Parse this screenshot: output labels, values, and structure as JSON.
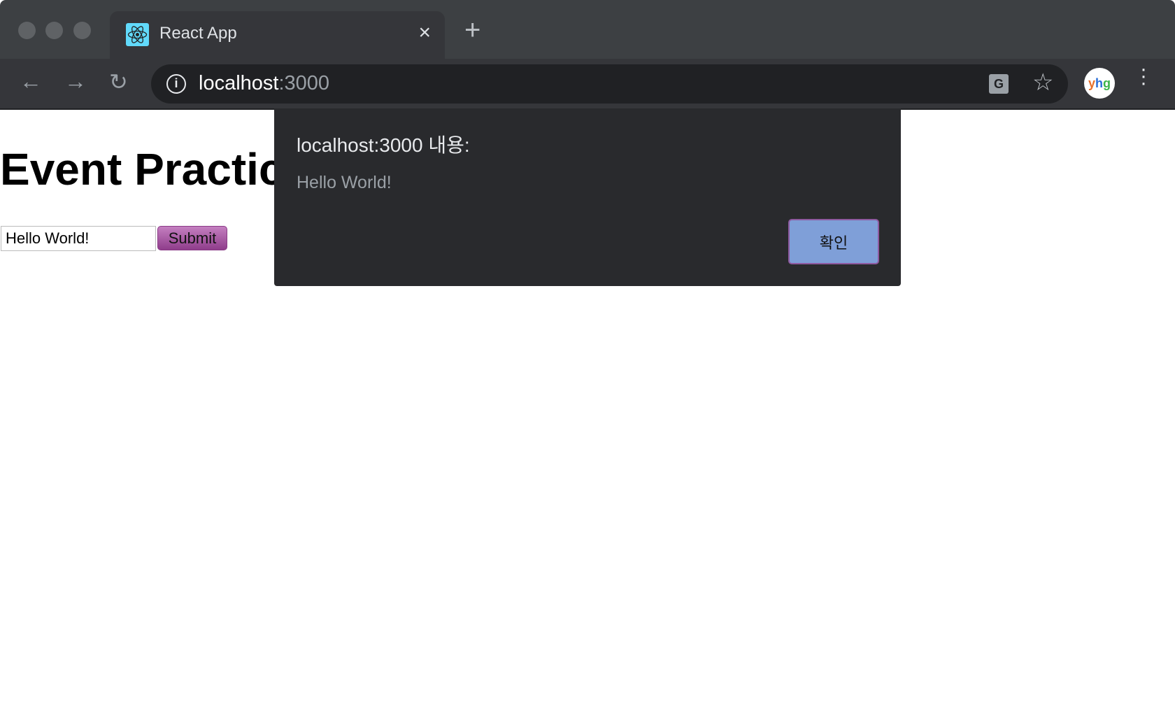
{
  "browser": {
    "tab": {
      "title": "React App",
      "favicon": "react-logo-icon",
      "close": "×"
    },
    "new_tab": "+",
    "url": {
      "host": "localhost",
      "port": ":3000"
    },
    "avatar_text": "yhg",
    "colors": {
      "tabbar": "#3d4043",
      "toolbar": "#35363a",
      "omnibox": "#202124"
    }
  },
  "page": {
    "heading": "Event Practice",
    "input_value": "Hello World!",
    "submit_label": "Submit"
  },
  "dialog": {
    "title": "localhost:3000 내용:",
    "message": "Hello World!",
    "ok_label": "확인",
    "colors": {
      "background": "#292a2d",
      "button": "#7f9fd8"
    }
  }
}
